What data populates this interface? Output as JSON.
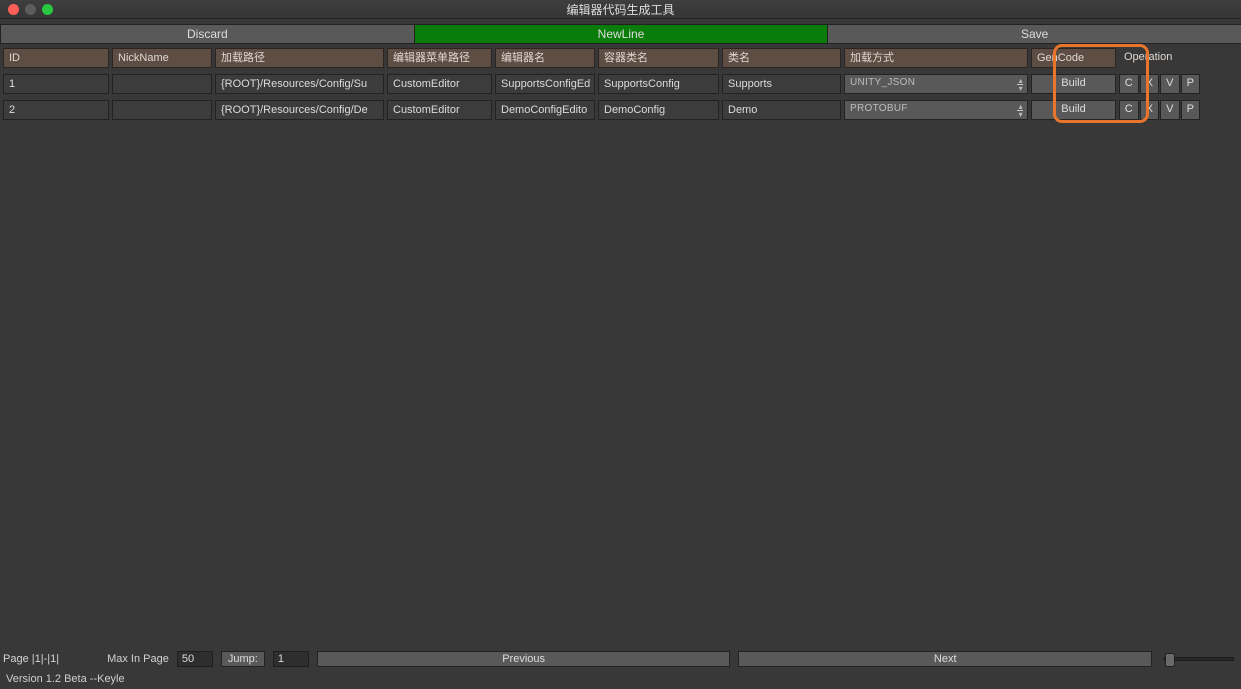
{
  "window": {
    "title": "编辑器代码生成工具"
  },
  "toolbar": {
    "discard": "Discard",
    "newline": "NewLine",
    "save": "Save"
  },
  "headers": {
    "id": "ID",
    "nickname": "NickName",
    "loadPath": "加载路径",
    "editorMenuPath": "编辑器菜单路径",
    "editorName": "编辑器名",
    "containerClass": "容器类名",
    "className": "类名",
    "loadMode": "加载方式",
    "genCode": "GenCode",
    "operation": "Operation"
  },
  "rows": [
    {
      "id": "1",
      "nickname": "",
      "loadPath": "{ROOT}/Resources/Config/Su",
      "editorMenuPath": "CustomEditor",
      "editorName": "SupportsConfigEd",
      "containerClass": "SupportsConfig",
      "className": "Supports",
      "loadMode": "UNITY_JSON",
      "build": "Build",
      "ops": {
        "c": "C",
        "x": "X",
        "v": "V",
        "p": "P"
      }
    },
    {
      "id": "2",
      "nickname": "",
      "loadPath": "{ROOT}/Resources/Config/De",
      "editorMenuPath": "CustomEditor",
      "editorName": "DemoConfigEdito",
      "containerClass": "DemoConfig",
      "className": "Demo",
      "loadMode": "PROTOBUF",
      "build": "Build",
      "ops": {
        "c": "C",
        "x": "X",
        "v": "V",
        "p": "P"
      }
    }
  ],
  "footer": {
    "pageLabel": "Page |1|-|1|",
    "maxInPageLabel": "Max In Page",
    "maxInPageValue": "50",
    "jumpLabel": "Jump:",
    "jumpValue": "1",
    "previous": "Previous",
    "next": "Next"
  },
  "version": "Version 1.2 Beta   --Keyle"
}
